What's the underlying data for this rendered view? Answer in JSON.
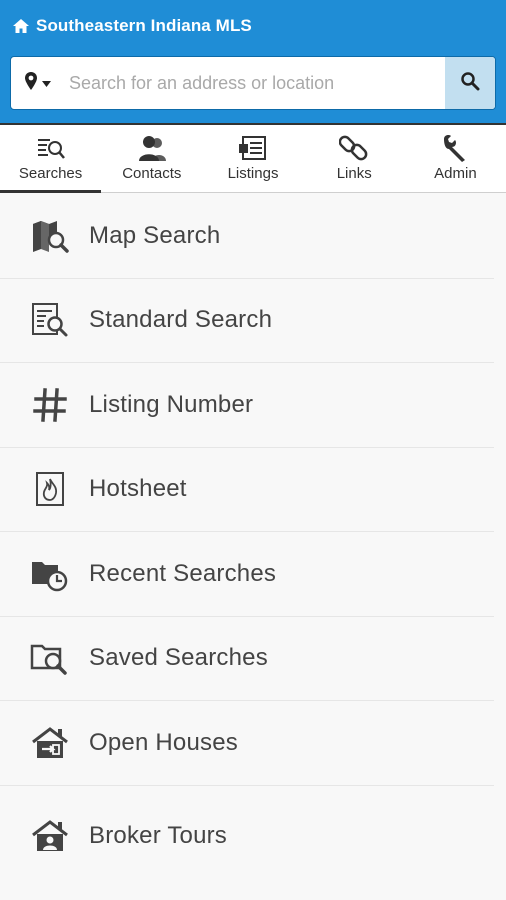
{
  "header": {
    "title": "Southeastern Indiana MLS",
    "home_icon": "home-icon",
    "background": "#1f8dd6"
  },
  "search": {
    "placeholder": "Search for an address or location",
    "value": "",
    "location_icon": "map-pin-icon",
    "dropdown_icon": "caret-down-icon",
    "button_icon": "search-icon"
  },
  "tabs": [
    {
      "label": "Searches",
      "icon": "searches-icon",
      "active": true
    },
    {
      "label": "Contacts",
      "icon": "contacts-icon",
      "active": false
    },
    {
      "label": "Listings",
      "icon": "listings-icon",
      "active": false
    },
    {
      "label": "Links",
      "icon": "links-icon",
      "active": false
    },
    {
      "label": "Admin",
      "icon": "wrench-icon",
      "active": false
    }
  ],
  "menu": [
    {
      "label": "Map Search",
      "icon": "map-search-icon"
    },
    {
      "label": "Standard Search",
      "icon": "document-search-icon"
    },
    {
      "label": "Listing Number",
      "icon": "hash-icon"
    },
    {
      "label": "Hotsheet",
      "icon": "hotsheet-fire-icon"
    },
    {
      "label": "Recent Searches",
      "icon": "folder-clock-icon"
    },
    {
      "label": "Saved Searches",
      "icon": "folder-search-icon"
    },
    {
      "label": "Open Houses",
      "icon": "open-house-icon"
    },
    {
      "label": "Broker Tours",
      "icon": "broker-tour-icon"
    }
  ]
}
